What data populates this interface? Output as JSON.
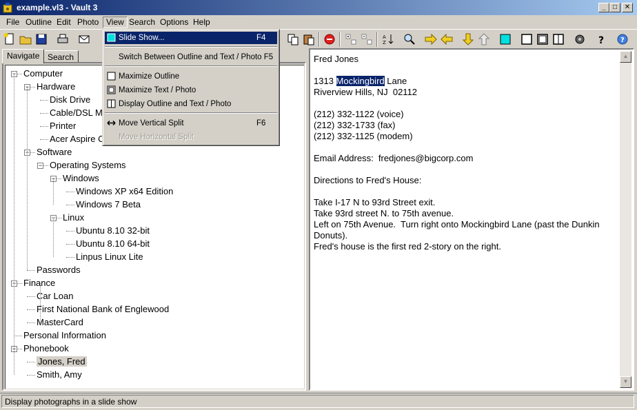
{
  "window": {
    "title": "example.vl3 - Vault 3"
  },
  "menubar": [
    "File",
    "Outline",
    "Edit",
    "Photo",
    "View",
    "Search",
    "Options",
    "Help"
  ],
  "view_menu": {
    "items": [
      {
        "label": "Slide Show...",
        "shortcut": "F4",
        "hover": true,
        "disabled": false
      },
      {
        "label": "Switch Between Outline and Text / Photo F5",
        "shortcut": "",
        "hover": false,
        "disabled": false
      },
      {
        "label": "Maximize Outline",
        "shortcut": "",
        "hover": false,
        "disabled": false
      },
      {
        "label": "Maximize Text / Photo",
        "shortcut": "",
        "hover": false,
        "disabled": false
      },
      {
        "label": "Display Outline and Text / Photo",
        "shortcut": "",
        "hover": false,
        "disabled": false
      },
      {
        "label": "Move Vertical Split",
        "shortcut": "F6",
        "hover": false,
        "disabled": false
      },
      {
        "label": "Move Horizontal Split",
        "shortcut": "",
        "hover": false,
        "disabled": true
      }
    ]
  },
  "tabs": [
    "Navigate",
    "Search"
  ],
  "tree": [
    {
      "label": "Computer"
    },
    {
      "label": "Hardware"
    },
    {
      "label": "Disk Drive"
    },
    {
      "label": "Cable/DSL M"
    },
    {
      "label": "Printer"
    },
    {
      "label": "Acer Aspire C"
    },
    {
      "label": "Software"
    },
    {
      "label": "Operating Systems"
    },
    {
      "label": "Windows"
    },
    {
      "label": "Windows XP x64 Edition"
    },
    {
      "label": "Windows 7 Beta"
    },
    {
      "label": "Linux"
    },
    {
      "label": "Ubuntu 8.10 32-bit"
    },
    {
      "label": "Ubuntu 8.10 64-bit"
    },
    {
      "label": "Linpus Linux Lite"
    },
    {
      "label": "Passwords"
    },
    {
      "label": "Finance"
    },
    {
      "label": "Car Loan"
    },
    {
      "label": "First National Bank of Englewood"
    },
    {
      "label": "MasterCard"
    },
    {
      "label": "Personal Information"
    },
    {
      "label": "Phonebook"
    },
    {
      "label": "Jones, Fred"
    },
    {
      "label": "Smith, Amy"
    }
  ],
  "content": {
    "name": "Fred Jones",
    "street_pre": "1313 ",
    "street_highlight": "Mockingbird",
    "street_post": " Lane",
    "city": "Riverview Hills, NJ  02112",
    "phone_voice": "(212) 332-1122 (voice)",
    "phone_fax": "(212) 332-1733 (fax)",
    "phone_modem": "(212) 332-1125 (modem)",
    "email": "Email Address:  fredjones@bigcorp.com",
    "directions_title": "Directions to Fred's House:",
    "directions_1": "Take I-17 N to 93rd Street exit.",
    "directions_2": "Take 93rd street N. to 75th avenue.",
    "directions_3": "Left on 75th Avenue.  Turn right onto Mockingbird Lane (past the Dunkin Donuts).",
    "directions_4": "Fred's house is the first red 2-story on the right."
  },
  "status": {
    "text": "Display photographs in a slide show"
  }
}
